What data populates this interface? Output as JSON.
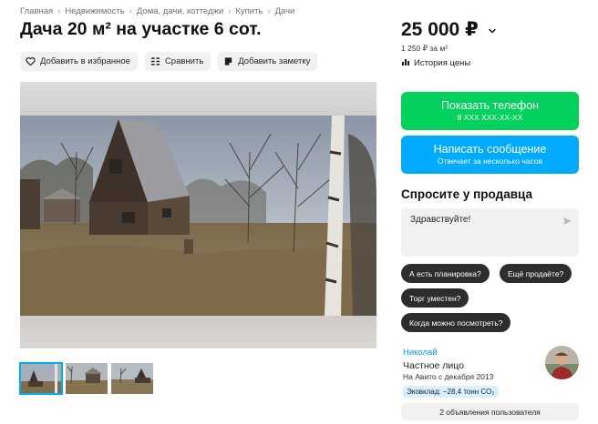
{
  "breadcrumb": [
    "Главная",
    "Недвижимость",
    "Дома, дачи, коттеджи",
    "Купить",
    "Дачи"
  ],
  "title": "Дача 20 м² на участке 6 сот.",
  "actions": {
    "favorite": "Добавить в избранное",
    "compare": "Сравнить",
    "note": "Добавить заметку"
  },
  "price": {
    "value": "25 000 ₽",
    "per_m2": "1 250 ₽ за м²",
    "history": "История цены"
  },
  "buttons": {
    "phone": {
      "label": "Показать телефон",
      "number": "8 XXX XXX-XX-XX"
    },
    "message": {
      "label": "Написать сообщение",
      "hint": "Отвечает за несколько часов"
    }
  },
  "ask": {
    "heading": "Спросите у продавца",
    "draft": "Здравствуйте!",
    "chips": [
      "А есть планировка?",
      "Ещё продаёте?",
      "Торг уместен?",
      "Когда можно посмотреть?"
    ]
  },
  "seller": {
    "name": "Николай",
    "type": "Частное лицо",
    "since": "На Авито с декабря 2013",
    "eco": "Эковклад: −28,4 тонн CO₂",
    "listings": "2 объявления пользователя"
  },
  "colors": {
    "green": "#02d15c",
    "blue": "#00aaff",
    "link": "#009cf0",
    "chip": "#2d2d2d",
    "pill_bg": "#f2f1f0"
  },
  "icons": [
    "heart-icon",
    "compare-icon",
    "note-icon",
    "chevron-down-icon",
    "chart-icon",
    "send-icon"
  ]
}
